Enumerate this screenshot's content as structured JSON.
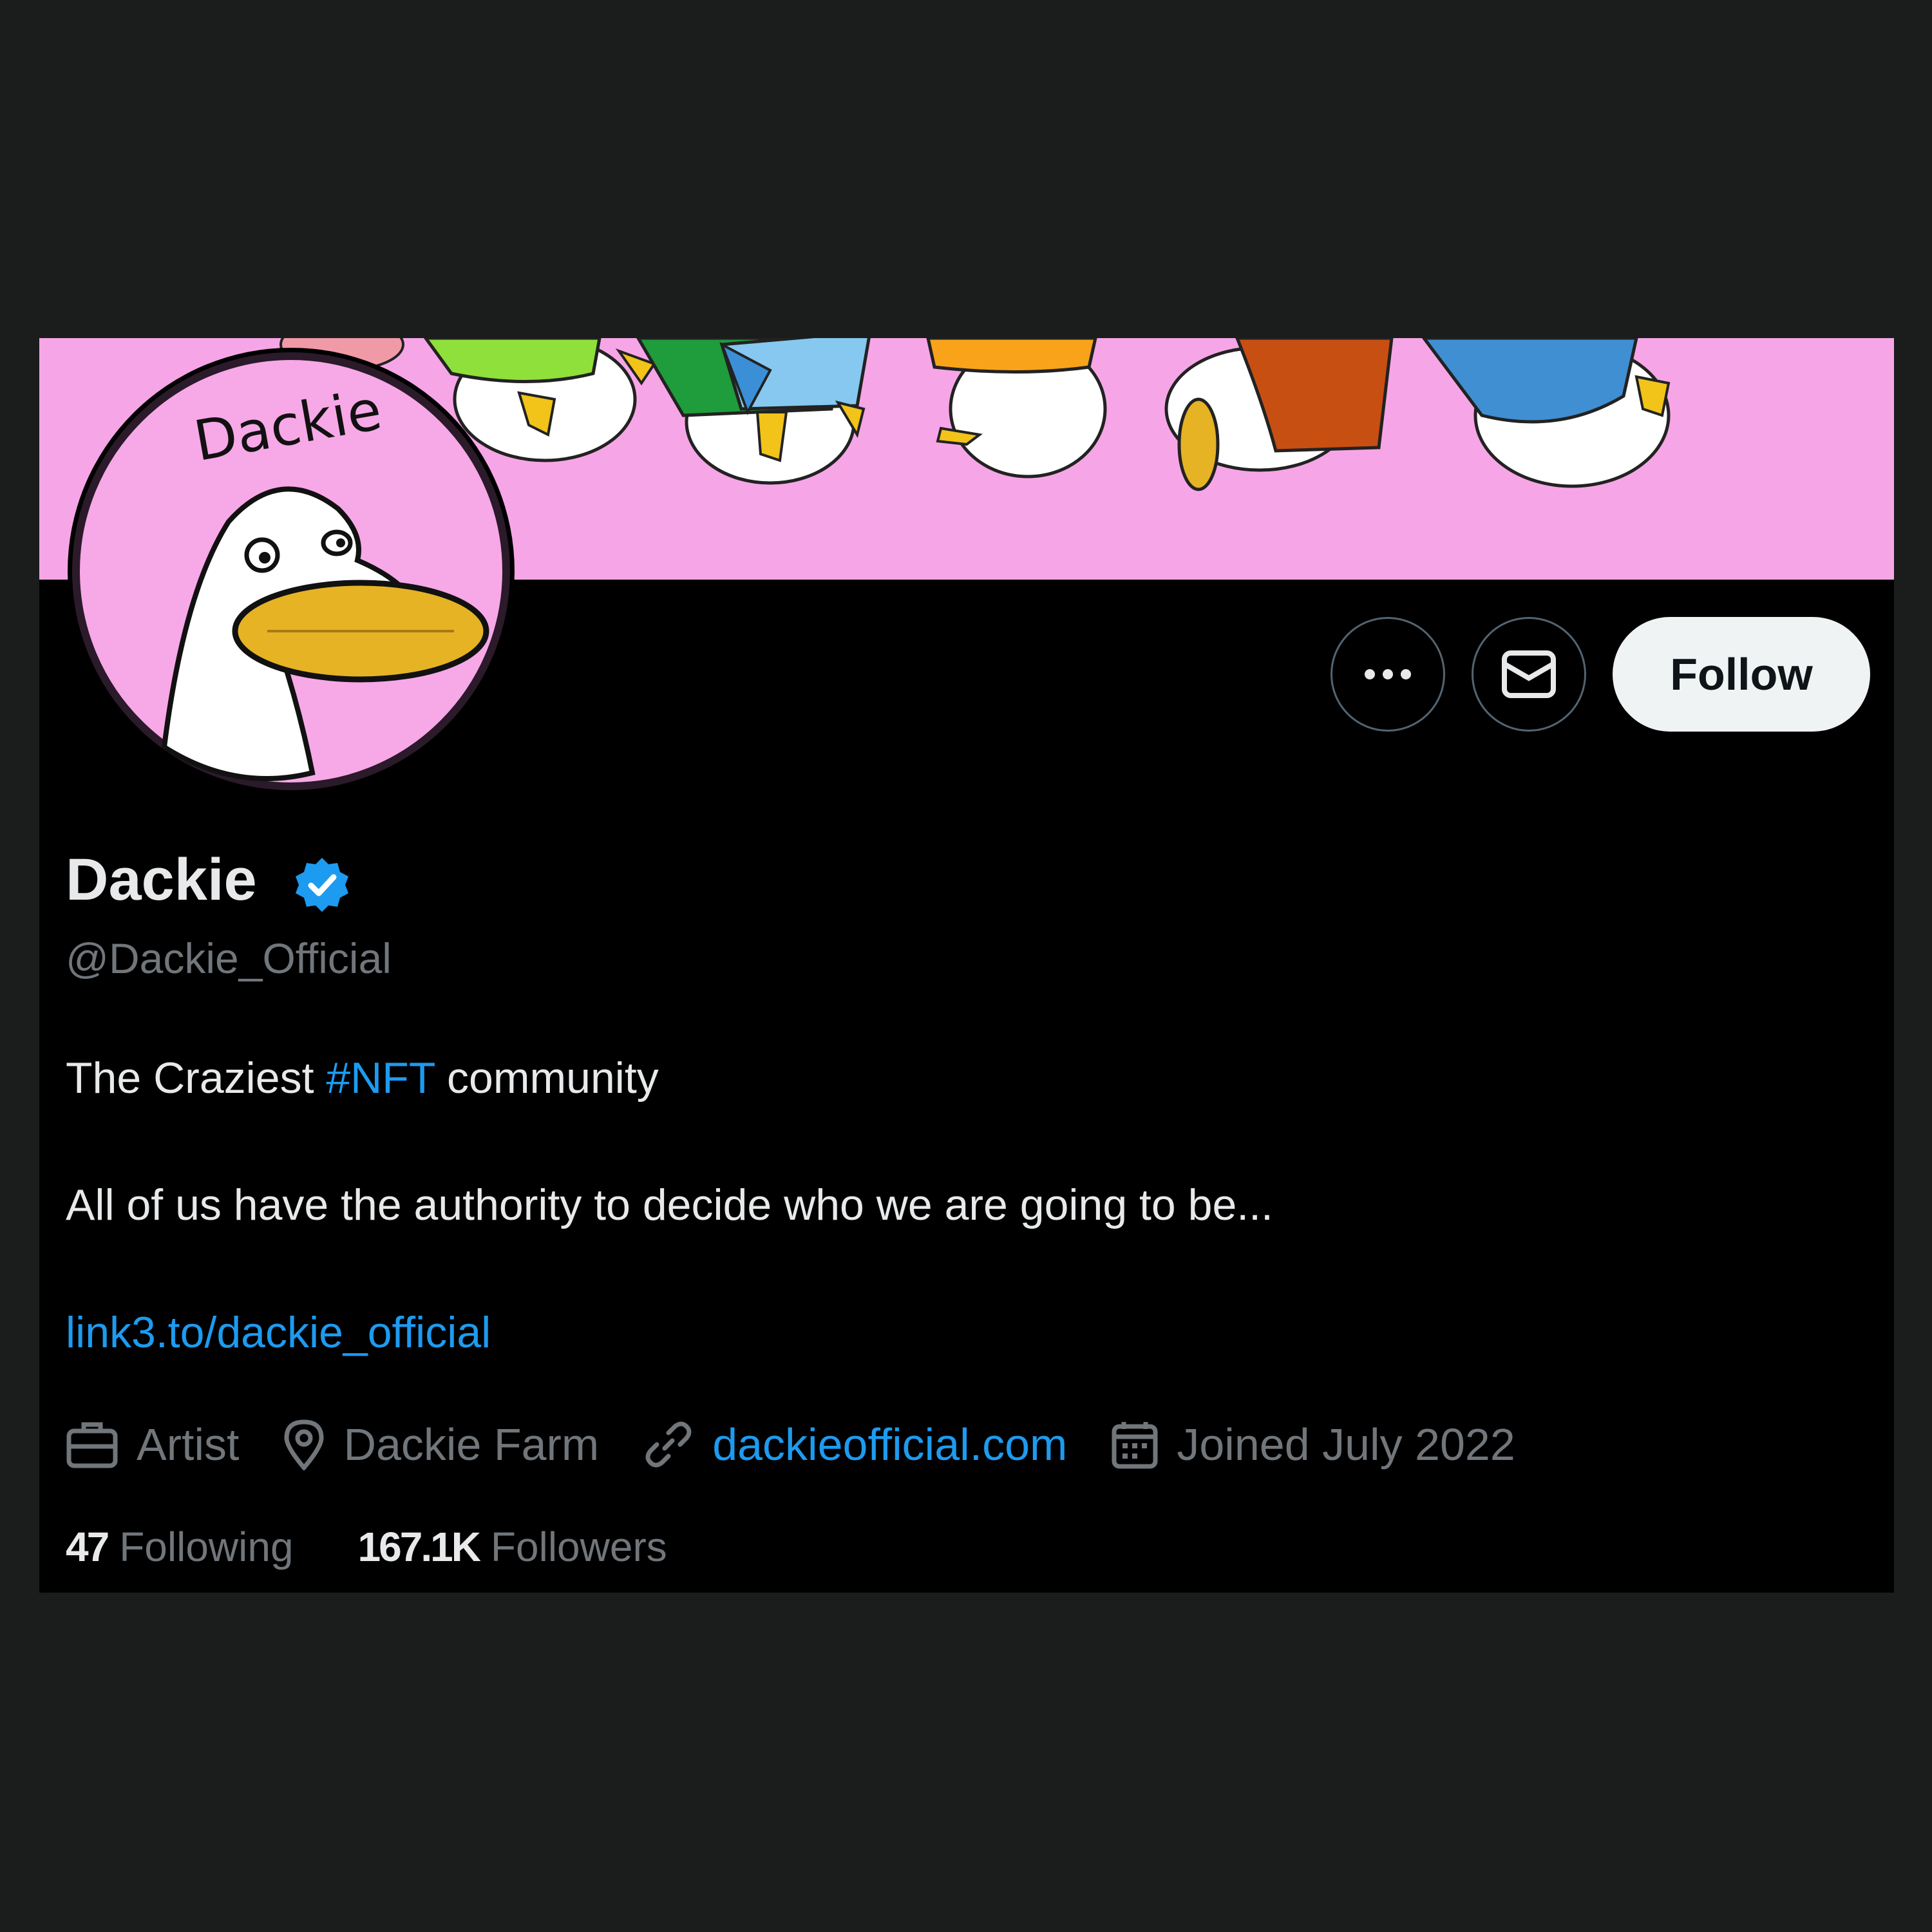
{
  "profile": {
    "avatar_text": "Dackie",
    "display_name": "Dackie",
    "verified_icon": "verified-badge-icon",
    "handle": "@Dackie_Official",
    "bio": {
      "line1_before": "The Craziest ",
      "line1_hashtag": "#NFT",
      "line1_after": " community",
      "line2": "All of us have the authority to decide who we are going to be...",
      "line3_link": "link3.to/dackie_official"
    },
    "meta": {
      "category": "Artist",
      "location": "Dackie Farm",
      "website": "dackieofficial.com",
      "joined": "Joined July 2022"
    },
    "stats": {
      "following_count": "47",
      "following_label": "Following",
      "followers_count": "167.1K",
      "followers_label": "Followers"
    }
  },
  "actions": {
    "more_icon": "more-icon",
    "message_icon": "envelope-icon",
    "follow_label": "Follow"
  },
  "colors": {
    "page_bg": "#1b1c1c",
    "card_bg": "#000000",
    "banner_bg": "#f6a6e6",
    "text_primary": "#e7e9ea",
    "text_secondary": "#71767b",
    "accent": "#1d9bf0",
    "follow_bg": "#eff3f4"
  }
}
